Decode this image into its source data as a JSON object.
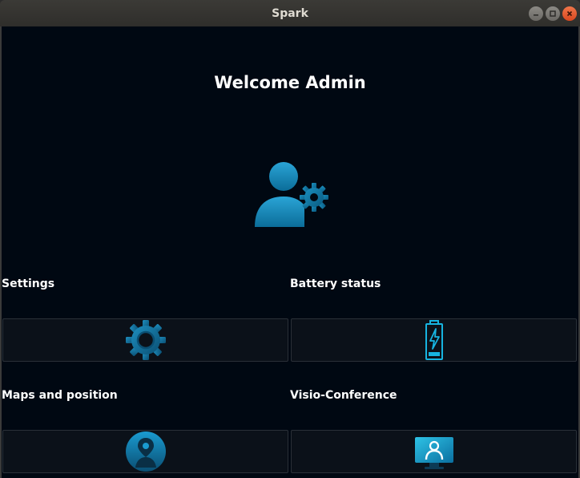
{
  "window": {
    "title": "Spark"
  },
  "main": {
    "welcome": "Welcome Admin",
    "sections": [
      {
        "label": "Settings",
        "icon": "gear-icon"
      },
      {
        "label": "Battery status",
        "icon": "battery-charging-icon"
      },
      {
        "label": "Maps and position",
        "icon": "map-pin-user-icon"
      },
      {
        "label": "Visio-Conference",
        "icon": "video-monitor-icon"
      }
    ]
  },
  "colors": {
    "background": "#000812",
    "tile": "#0b1119",
    "accent": "#1aa0cf",
    "accent_dark": "#0a5e86"
  }
}
